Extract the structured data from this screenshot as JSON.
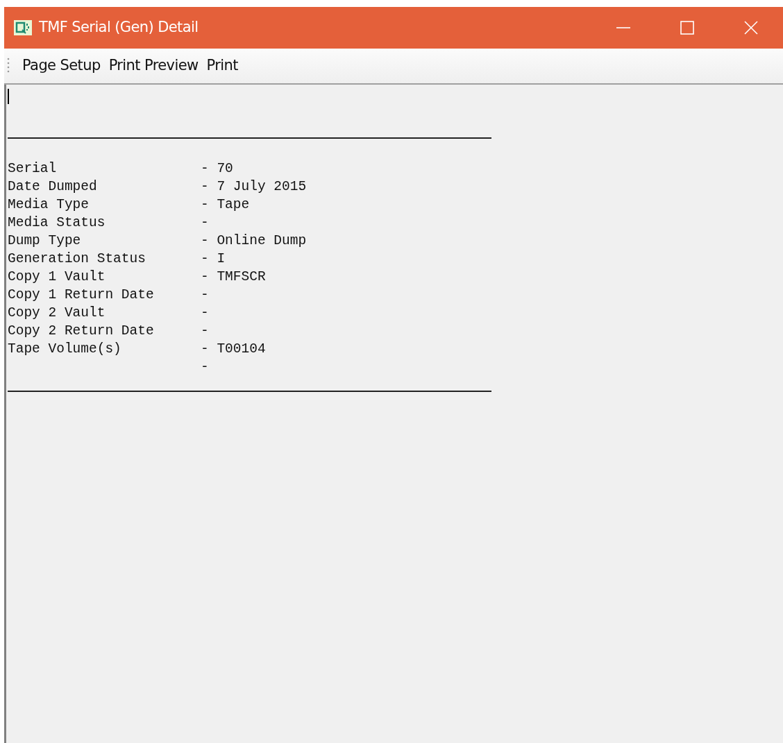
{
  "window": {
    "title": "TMF Serial (Gen) Detail"
  },
  "menu": [
    "Page Setup",
    "Print Preview",
    "Print"
  ],
  "report": {
    "rows": [
      {
        "label": "Serial",
        "value": "- 70"
      },
      {
        "label": "Date Dumped",
        "value": "- 7 July 2015"
      },
      {
        "label": "Media Type",
        "value": "- Tape"
      },
      {
        "label": "Media Status",
        "value": "-"
      },
      {
        "label": "Dump Type",
        "value": "- Online Dump"
      },
      {
        "label": "Generation Status",
        "value": "- I"
      },
      {
        "label": "Copy 1 Vault",
        "value": "- TMFSCR"
      },
      {
        "label": "Copy 1 Return Date",
        "value": "-"
      },
      {
        "label": "Copy 2 Vault",
        "value": "-"
      },
      {
        "label": "Copy 2 Return Date",
        "value": "-"
      },
      {
        "label": "Tape Volume(s)",
        "value": "- T00104"
      },
      {
        "value": "-"
      }
    ]
  }
}
